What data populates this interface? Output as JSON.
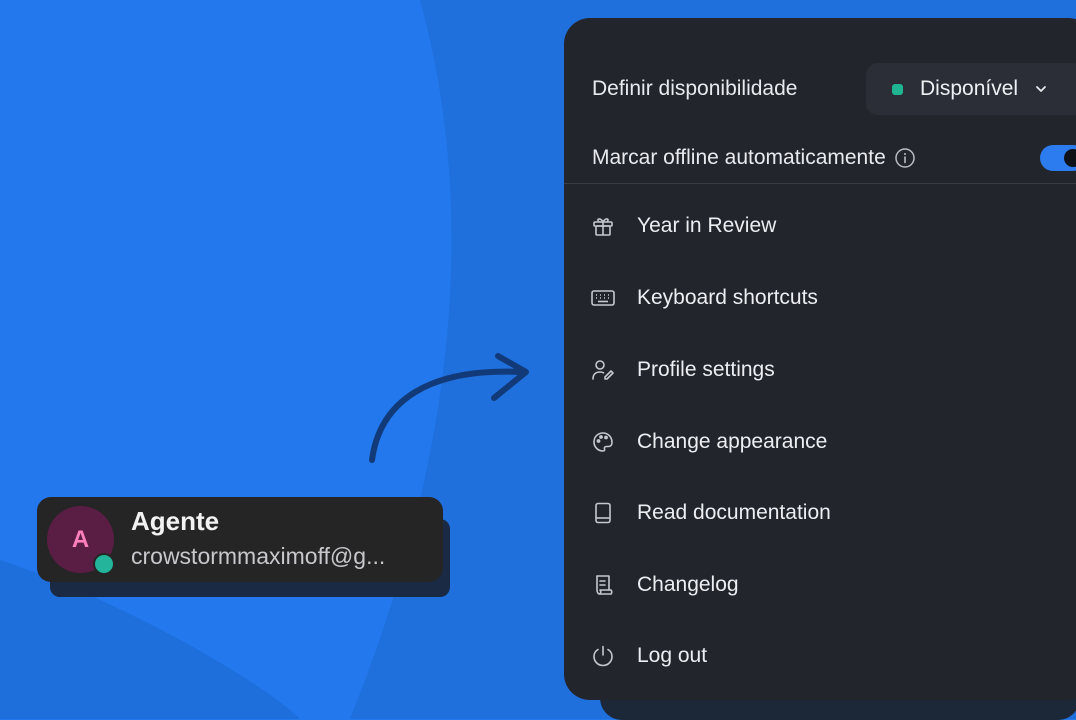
{
  "menu": {
    "availability_label": "Definir disponibilidade",
    "availability_value": "Disponível",
    "availability_color": "#1fb592",
    "auto_offline_label": "Marcar offline automaticamente",
    "auto_offline_enabled": true,
    "items": [
      {
        "label": "Year in Review",
        "icon": "gift-icon"
      },
      {
        "label": "Keyboard shortcuts",
        "icon": "keyboard-icon"
      },
      {
        "label": "Profile settings",
        "icon": "user-edit-icon"
      },
      {
        "label": "Change appearance",
        "icon": "palette-icon"
      },
      {
        "label": "Read documentation",
        "icon": "book-icon"
      },
      {
        "label": "Changelog",
        "icon": "scroll-icon"
      },
      {
        "label": "Log out",
        "icon": "power-icon"
      }
    ]
  },
  "agent": {
    "initial": "A",
    "name": "Agente",
    "email": "crowstormmaximoff@g...",
    "presence_color": "#23b49b"
  },
  "colors": {
    "background": "#2278ec",
    "panel": "#22252c",
    "accent": "#2c7cf0"
  }
}
